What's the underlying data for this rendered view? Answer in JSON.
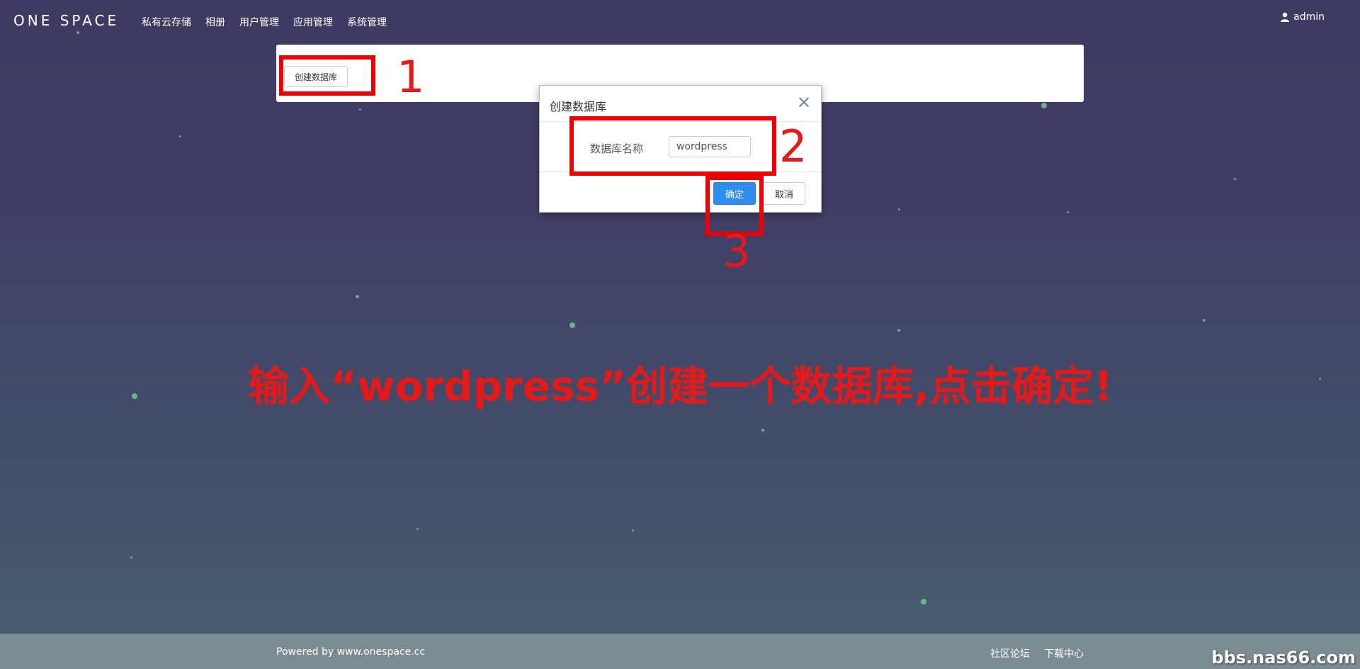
{
  "brand": "ONE SPACE",
  "nav": [
    "私有云存储",
    "相册",
    "用户管理",
    "应用管理",
    "系统管理"
  ],
  "user": {
    "name": "admin",
    "icon": "user-icon"
  },
  "panel": {
    "create_button": "创建数据库"
  },
  "modal": {
    "title": "创建数据库",
    "close_icon": "close-icon",
    "field_label": "数据库名称",
    "field_value": "wordpress",
    "ok_label": "确定",
    "cancel_label": "取消"
  },
  "annotations": {
    "step1": "1",
    "step2": "2",
    "step3": "3",
    "instruction": "输入“wordpress”创建一个数据库,点击确定!",
    "color": "#e41a1a"
  },
  "footer": {
    "powered": "Powered by www.onespace.cc",
    "links": [
      "社区论坛",
      "下载中心"
    ],
    "watermark": "bbs.nas66.com"
  },
  "colors": {
    "primary_button": "#2e8ded",
    "background_top": "#3f3a61",
    "footer": "#7a8b92"
  }
}
